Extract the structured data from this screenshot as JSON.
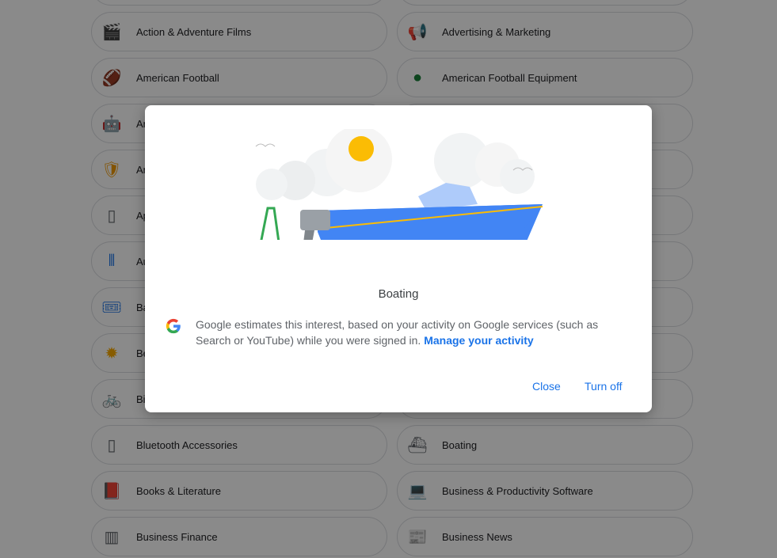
{
  "interests": {
    "left": [
      {
        "label": "",
        "icon": "pill-icon"
      },
      {
        "label": "Action & Adventure Films",
        "icon": "clapperboard-icon"
      },
      {
        "label": "American Football",
        "icon": "football-icon"
      },
      {
        "label": "An",
        "icon": "android-icon"
      },
      {
        "label": "An",
        "icon": "shield-check-icon"
      },
      {
        "label": "Ap",
        "icon": "phone-icon"
      },
      {
        "label": "Au",
        "icon": "audio-wave-icon"
      },
      {
        "label": "Ba",
        "icon": "ticket-icon"
      },
      {
        "label": "Be",
        "icon": "sun-icon"
      },
      {
        "label": "Bi",
        "icon": "bicycle-icon"
      },
      {
        "label": "Bluetooth Accessories",
        "icon": "phone-icon"
      },
      {
        "label": "Books & Literature",
        "icon": "book-icon"
      },
      {
        "label": "Business Finance",
        "icon": "bar-chart-icon"
      }
    ],
    "right": [
      {
        "label": "",
        "icon": ""
      },
      {
        "label": "Advertising & Marketing",
        "icon": "megaphone-icon"
      },
      {
        "label": "American Football Equipment",
        "icon": "ball-icon"
      },
      {
        "label": "",
        "icon": ""
      },
      {
        "label": "",
        "icon": ""
      },
      {
        "label": "",
        "icon": ""
      },
      {
        "label": "",
        "icon": ""
      },
      {
        "label": "",
        "icon": ""
      },
      {
        "label": "",
        "icon": ""
      },
      {
        "label": "",
        "icon": ""
      },
      {
        "label": "Boating",
        "icon": "ship-icon"
      },
      {
        "label": "Business & Productivity Software",
        "icon": "laptop-icon"
      },
      {
        "label": "Business News",
        "icon": "newspaper-icon"
      }
    ]
  },
  "dialog": {
    "title": "Boating",
    "description": "Google estimates this interest, based on your activity on Google services (such as Search or YouTube) while you were signed in.",
    "link": "Manage your activity",
    "close": "Close",
    "turn_off": "Turn off"
  },
  "colors": {
    "accent": "#1a73e8",
    "boat": "#4285f4"
  }
}
